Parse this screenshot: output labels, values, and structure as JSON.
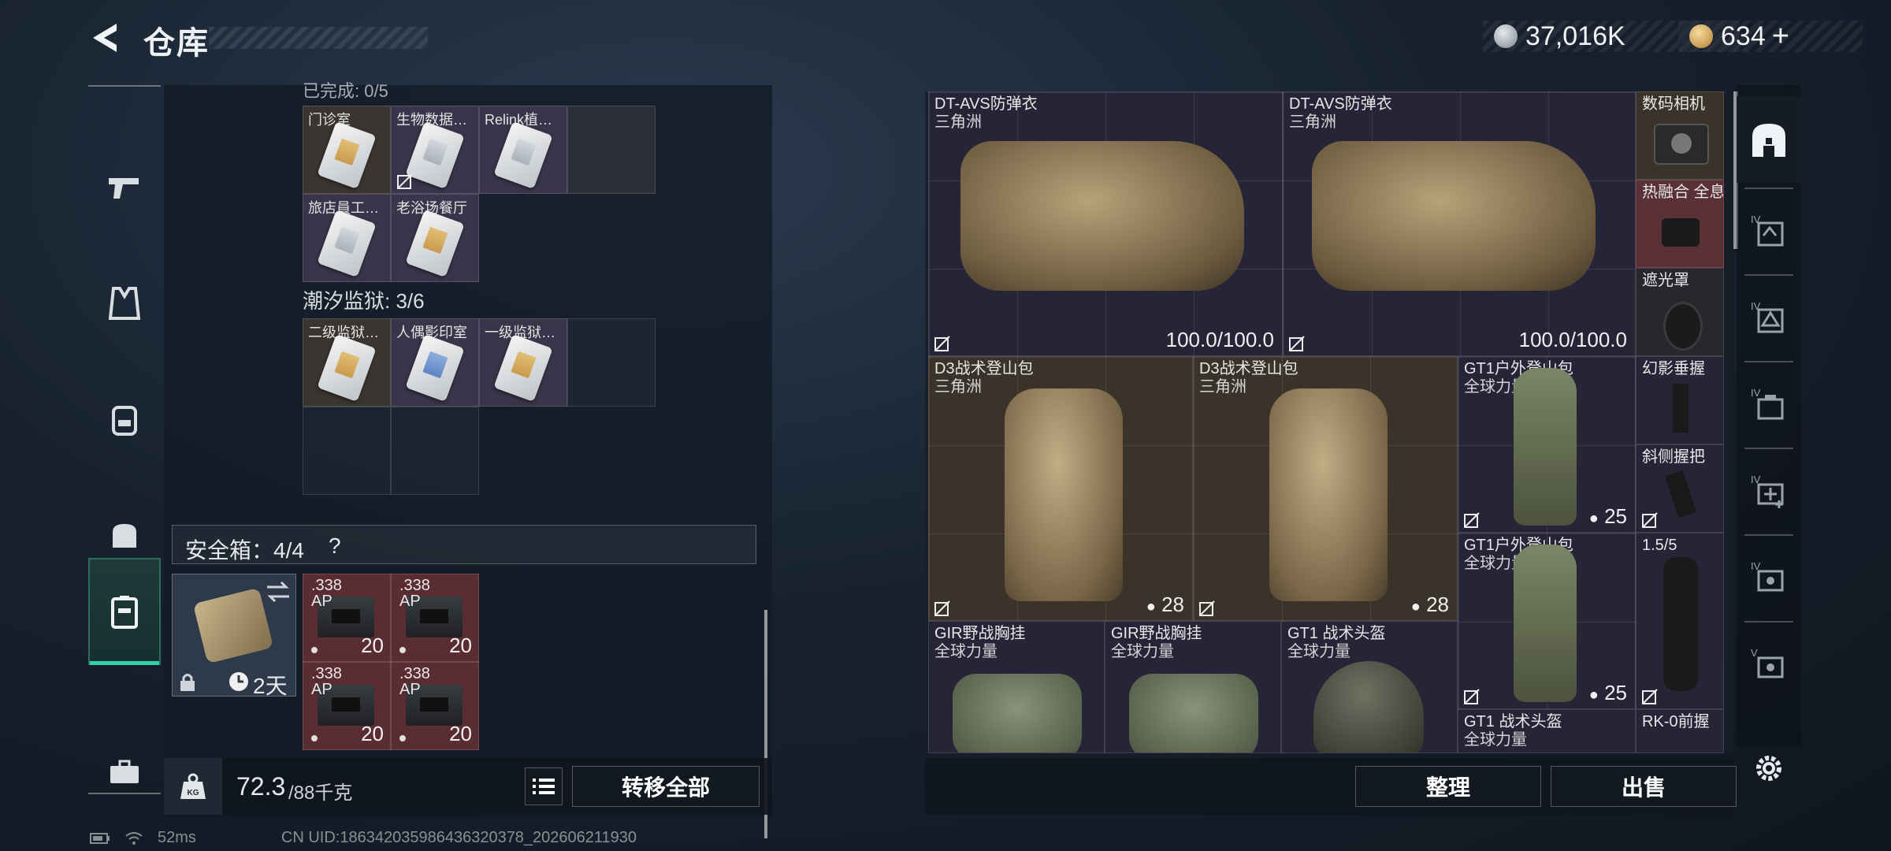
{
  "header": {
    "title": "仓库",
    "currency1": "37,016K",
    "currency2": "634",
    "currency2_plus": "+"
  },
  "left_nav": [
    "pistol-icon",
    "vest-icon",
    "backpack-icon",
    "pouch-icon",
    "safe-box-icon",
    "toolbox-icon"
  ],
  "keycards": {
    "section1_header": "已完成: 0/5",
    "section1_items": [
      "门诊室",
      "生物数据…",
      "Relink植…",
      "旅店員工…",
      "老浴场餐厅"
    ],
    "section2_header": "潮汐监狱: 3/6",
    "section2_items": [
      "二级监狱…",
      "人偶影印室",
      "一级监狱…"
    ]
  },
  "safebox": {
    "header": "安全箱：4/4",
    "help": "?",
    "timer": "2天",
    "ammo": [
      {
        "cal": ".338",
        "type": "AP",
        "count": "20"
      },
      {
        "cal": ".338",
        "type": "AP",
        "count": "20"
      },
      {
        "cal": ".338",
        "type": "AP",
        "count": "20"
      },
      {
        "cal": ".338",
        "type": "AP",
        "count": "20"
      }
    ]
  },
  "bottom_left": {
    "weight": "72.3",
    "capacity": "/88千克",
    "kg_badge": "KG",
    "transfer_all": "转移全部"
  },
  "right": {
    "armor1": {
      "name": "DT-AVS防弹衣",
      "sub": "三角洲",
      "dur": "100.0/100.0"
    },
    "armor2": {
      "name": "DT-AVS防弹衣",
      "sub": "三角洲",
      "dur": "100.0/100.0"
    },
    "camera": {
      "name": "数码相机"
    },
    "scope": {
      "name": "热融合 全息"
    },
    "hood": {
      "name": "遮光罩"
    },
    "bag1": {
      "name": "D3战术登山包",
      "sub": "三角洲",
      "cap": "28"
    },
    "bag2": {
      "name": "D3战术登山包",
      "sub": "三角洲",
      "cap": "28"
    },
    "gt1a": {
      "name": "GT1户外登山包",
      "sub": "全球力量",
      "cap": "25"
    },
    "gt1b": {
      "name": "GT1户外登山包",
      "sub": "全球力量",
      "cap": "25"
    },
    "grip1": {
      "name": "幻影垂握"
    },
    "grip2": {
      "name": "斜侧握把"
    },
    "optic": {
      "name": "1.5/5"
    },
    "rig1": {
      "name": "GIR野战胸挂",
      "sub": "全球力量"
    },
    "rig2": {
      "name": "GIR野战胸挂",
      "sub": "全球力量"
    },
    "helmet1": {
      "name": "GT1 战术头盔",
      "sub": "全球力量"
    },
    "helmet2": {
      "name": "GT1 战术头盔",
      "sub": "全球力量"
    },
    "foregrip": {
      "name": "RK-0前握"
    }
  },
  "bottom_right": {
    "sort": "整理",
    "sell": "出售"
  },
  "right_nav": {
    "roman4": "IV",
    "roman5": "V",
    "items": [
      "storage-home-icon",
      "armor-tier4-icon",
      "helmet-tier4-icon",
      "case-tier4-icon",
      "medkit-tier4-icon",
      "parts-tier4-icon",
      "parts-tier5-icon"
    ]
  },
  "status": {
    "ping": "52ms",
    "uid": "CN UID:18634203598643632037​8_202606211930"
  }
}
